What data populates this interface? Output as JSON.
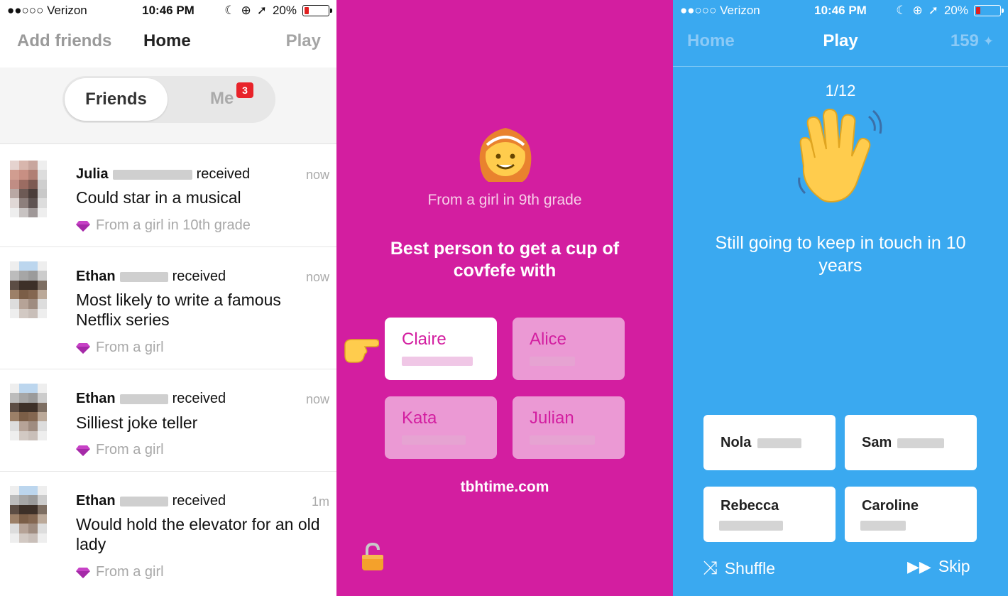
{
  "panel_home": {
    "status": {
      "carrier": "●●○○○ Verizon",
      "time": "10:46 PM",
      "battery": "20%"
    },
    "nav": {
      "left": "Add friends",
      "title": "Home",
      "right": "Play"
    },
    "segment": {
      "active": "Friends",
      "inactive": "Me",
      "badge": "3"
    },
    "feed": [
      {
        "name": "Julia",
        "verb": "received",
        "time": "now",
        "message": "Could star in a musical",
        "from": "From a girl in 10th grade"
      },
      {
        "name": "Ethan",
        "verb": "received",
        "time": "now",
        "message": "Most likely to write a famous Netflix series",
        "from": "From a girl"
      },
      {
        "name": "Ethan",
        "verb": "received",
        "time": "now",
        "message": "Silliest joke teller",
        "from": "From a girl"
      },
      {
        "name": "Ethan",
        "verb": "received",
        "time": "1m",
        "message": "Would hold the elevator for an old lady",
        "from": "From a girl"
      }
    ]
  },
  "panel_message": {
    "from": "From a girl in 9th grade",
    "question": "Best person to get a cup of covfefe with",
    "options": [
      "Claire",
      "Alice",
      "Kata",
      "Julian"
    ],
    "selected": "Claire",
    "website": "tbhtime.com"
  },
  "panel_play": {
    "status": {
      "carrier": "●●○○○ Verizon",
      "time": "10:46 PM",
      "battery": "20%"
    },
    "nav": {
      "left": "Home",
      "title": "Play",
      "score": "159"
    },
    "counter": "1/12",
    "question": "Still going to keep in touch in 10 years",
    "options": [
      "Nola",
      "Sam",
      "Rebecca",
      "Caroline"
    ],
    "shuffle": "Shuffle",
    "skip": "Skip"
  },
  "colors": {
    "pink": "#d31ea0",
    "blue": "#3aa9f0",
    "badge_red": "#e8232a"
  }
}
